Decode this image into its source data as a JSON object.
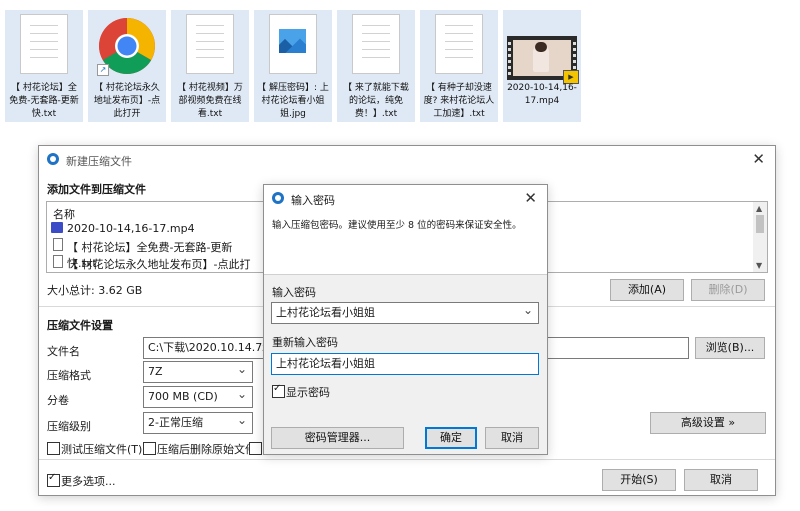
{
  "desktop": {
    "files": [
      {
        "name": "【 村花论坛】全免费-无套路-更新快.txt",
        "icon": "text-file-icon"
      },
      {
        "name": "【 村花论坛永久地址发布页】-点此打开",
        "icon": "chrome-icon"
      },
      {
        "name": "【 村花视频】万部视频免费在线看.txt",
        "icon": "text-file-icon"
      },
      {
        "name": "【 解压密码】: 上村花论坛看小姐姐.jpg",
        "icon": "image-file-icon"
      },
      {
        "name": "【 来了就能下载的论坛，纯免费！】.txt",
        "icon": "text-file-icon"
      },
      {
        "name": "【 有种子却没速度? 来村花论坛人工加速】.txt",
        "icon": "text-file-icon"
      },
      {
        "name": "2020-10-14,16-17.mp4",
        "icon": "video-file-icon"
      }
    ]
  },
  "archive_dialog": {
    "title": "新建压缩文件",
    "add_files_header": "添加文件到压缩文件",
    "list_header": "名称",
    "list_items": [
      "2020-10-14,16-17.mp4",
      "【 村花论坛】全免费-无套路-更新快.txt",
      "【 村花论坛永久地址发布页】-点此打开.url"
    ],
    "total_size": "大小总计: 3.62 GB",
    "add_button": "添加(A)",
    "delete_button": "删除(D)",
    "settings_header": "压缩文件设置",
    "filename_label": "文件名",
    "filename_value": "C:\\下载\\2020.10.14.7z",
    "browse_button": "浏览(B)...",
    "format_label": "压缩格式",
    "format_value": "7Z",
    "volume_label": "分卷",
    "volume_value": "700 MB (CD)",
    "level_label": "压缩级别",
    "level_value": "2-正常压缩",
    "advanced_button": "高级设置 »",
    "test_checkbox": "测试压缩文件(T)",
    "delete_source_checkbox": "压缩后删除原始文件",
    "more_options": "更多选项...",
    "start_button": "开始(S)",
    "cancel_button": "取消"
  },
  "password_dialog": {
    "title": "输入密码",
    "description": "输入压缩包密码。建议使用至少 8 位的密码来保证安全性。",
    "password_label": "输入密码",
    "password_value": "上村花论坛看小姐姐",
    "confirm_label": "重新输入密码",
    "confirm_value": "上村花论坛看小姐姐",
    "show_password": "显示密码",
    "manager_button": "密码管理器...",
    "ok_button": "确定",
    "cancel_button": "取消"
  }
}
